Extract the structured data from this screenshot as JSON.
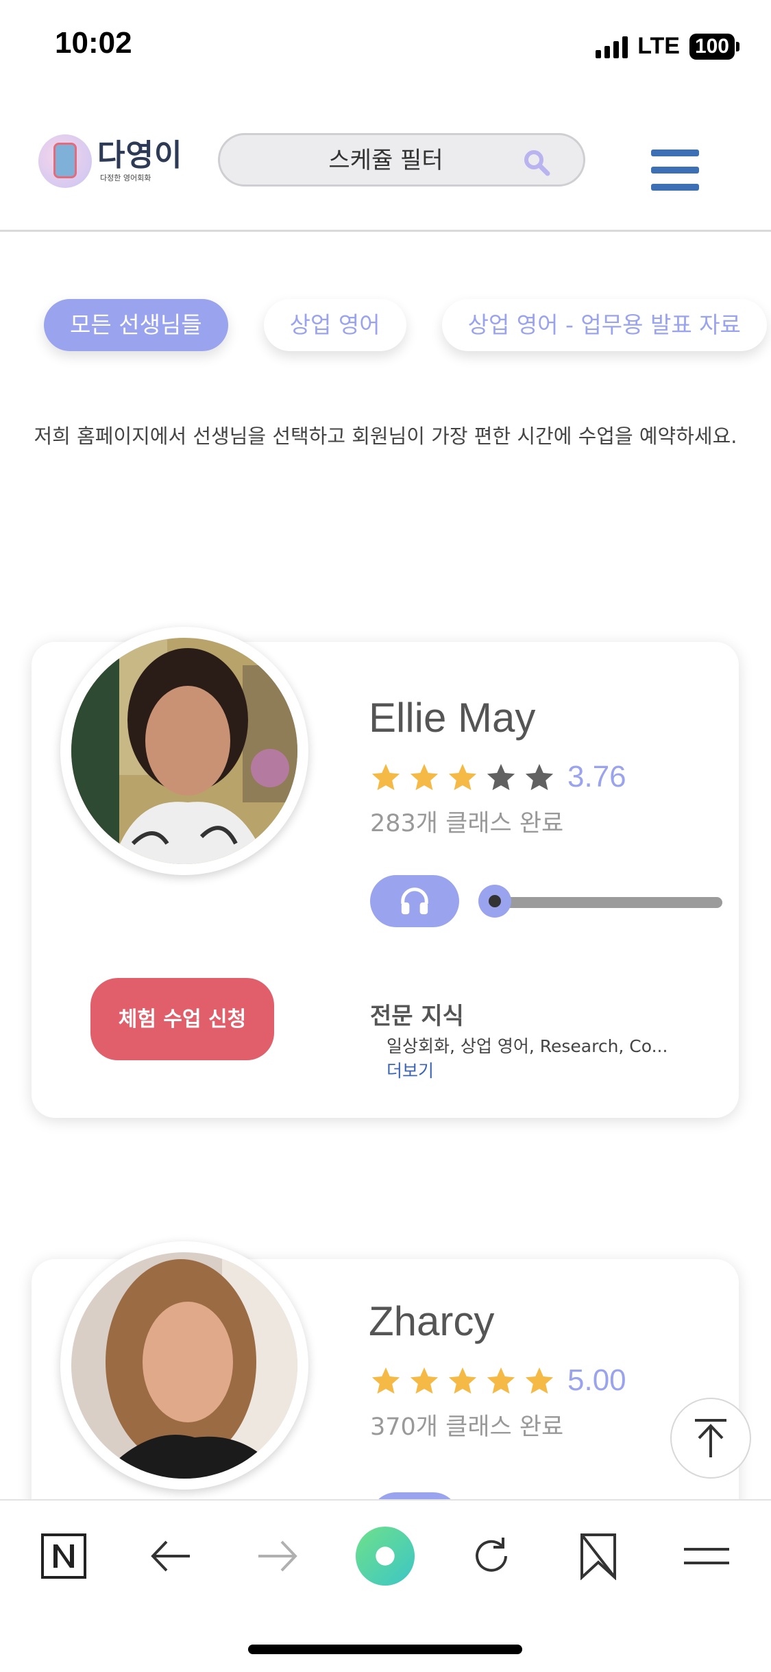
{
  "status_bar": {
    "time": "10:02",
    "network": "LTE",
    "battery": "100"
  },
  "header": {
    "logo_title": "다영이",
    "logo_subtitle": "다정한 영어회화",
    "search_placeholder": "스케쥴 필터"
  },
  "filters": [
    {
      "label": "모든 선생님들",
      "active": true
    },
    {
      "label": "상업 영어",
      "active": false
    },
    {
      "label": "상업 영어 - 업무용 발표 자료",
      "active": false
    }
  ],
  "intro_text": "저희 홈페이지에서 선생님을 선택하고 회원님이 가장 편한 시간에 수업을 예약하세요.",
  "teachers": [
    {
      "name": "Ellie May",
      "rating": "3.76",
      "rating_value": 3.76,
      "classes_completed": "283개 클래스 완료",
      "audio_progress": 0,
      "trial_button": "체험 수업 신청",
      "expertise_title": "전문 지식",
      "expertise": "일상회화, 상업 영어, Research, Co...",
      "more_link": "더보기"
    },
    {
      "name": "Zharcy",
      "rating": "5.00",
      "rating_value": 5.0,
      "classes_completed": "370개 클래스 완료"
    }
  ],
  "colors": {
    "accent": "#9aa3ee",
    "star": "#f5b945",
    "star_empty": "#616161",
    "trial_button": "#e05f6b",
    "menu": "#3d6fb5",
    "link": "#3a64b5"
  },
  "bottom_bar": {
    "icons": [
      "naver-n-icon",
      "back-arrow-icon",
      "forward-arrow-icon",
      "green-dot-icon",
      "refresh-icon",
      "bookmark-icon",
      "menu-icon"
    ]
  }
}
